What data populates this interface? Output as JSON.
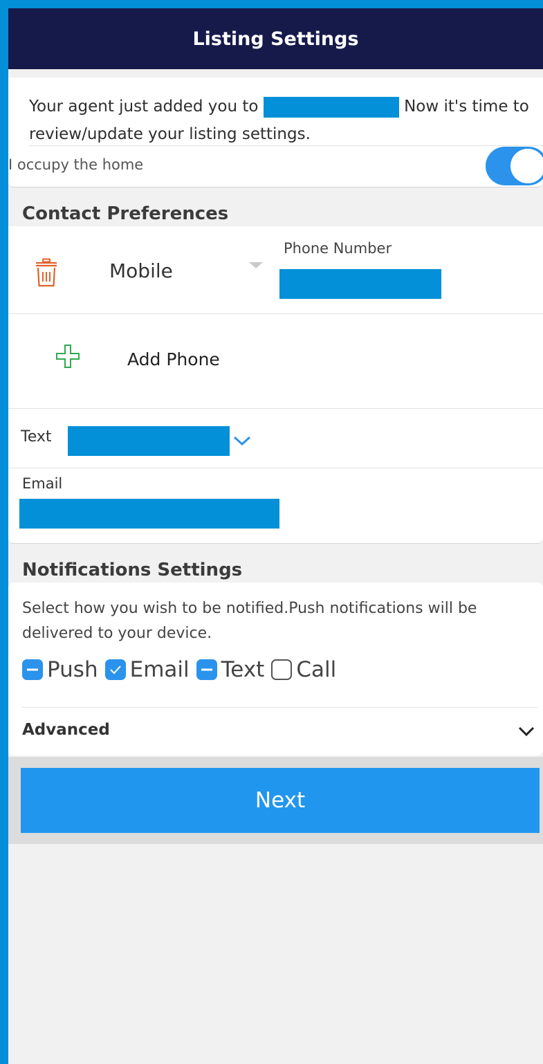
{
  "header": {
    "title": "Listing Settings"
  },
  "intro": {
    "text_before": "Your agent just added you to ",
    "text_after": " Now it's time to review/update your listing settings.",
    "occupy_label": "I occupy the home",
    "occupy_on": true
  },
  "contact": {
    "section_title": "Contact Preferences",
    "phone_type": "Mobile",
    "phone_label": "Phone Number",
    "add_phone_label": "Add Phone",
    "text_label": "Text",
    "email_label": "Email"
  },
  "notifications": {
    "section_title": "Notifications Settings",
    "description": "Select how you wish to be notified.Push notifications will be delivered to your device.",
    "channels": [
      {
        "label": "Push",
        "state": "partial"
      },
      {
        "label": "Email",
        "state": "checked"
      },
      {
        "label": "Text",
        "state": "partial"
      },
      {
        "label": "Call",
        "state": "unchecked"
      }
    ],
    "advanced_label": "Advanced"
  },
  "footer": {
    "next_label": "Next"
  },
  "colors": {
    "header_bg": "#161a4a",
    "accent": "#2b93eb",
    "redaction": "#0390d8",
    "delete_icon": "#e0622c",
    "add_icon": "#2fa84f"
  }
}
